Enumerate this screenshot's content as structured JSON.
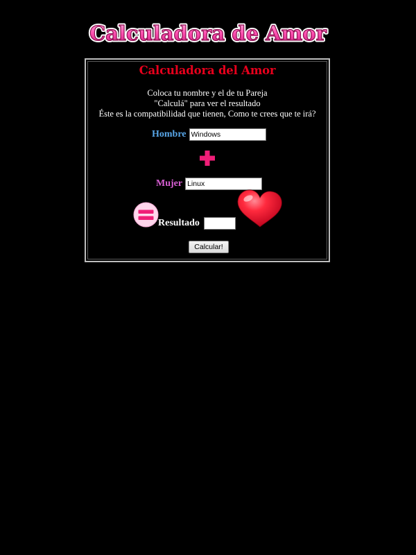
{
  "banner": {
    "text": "Calculadora de Amor"
  },
  "panel": {
    "title": "Calculadora del Amor",
    "intro_lines": [
      "Coloca tu nombre y el de tu Pareja",
      "\"Calculá\" para ver el resultado",
      "Éste es la compatibilidad que tienen, Como te crees que te irá?"
    ],
    "hombre": {
      "label": "Hombre",
      "value": "Windows"
    },
    "mujer": {
      "label": "Mujer",
      "value": "Linux"
    },
    "resultado": {
      "label": "Resultado",
      "value": ""
    },
    "calcular_label": "Calcular!"
  },
  "icons": {
    "plus": "plus-icon",
    "equals": "equals-icon",
    "heart": "heart-icon"
  },
  "colors": {
    "background": "#000000",
    "title_red": "#e8001c",
    "hombre_blue": "#58a6e8",
    "mujer_pink": "#d75fd3",
    "accent_pink": "#f01e78",
    "heart_red": "#ee1530",
    "banner_pink": "#ff4fb0"
  }
}
